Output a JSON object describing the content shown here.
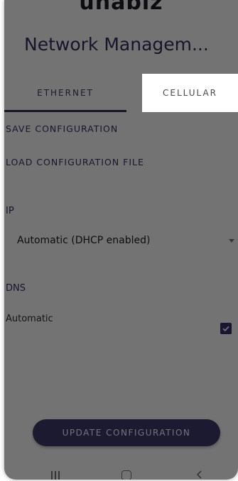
{
  "app": {
    "brand": "unabiz",
    "title": "Network Managem..."
  },
  "tabs": [
    {
      "label": "ETHERNET",
      "selected": true
    },
    {
      "label": "CELLULAR",
      "selected": false
    }
  ],
  "actions": {
    "save": "SAVE CONFIGURATION",
    "load": "LOAD CONFIGURATION FILE"
  },
  "ip": {
    "label": "IP",
    "selected": "Automatic (DHCP enabled)"
  },
  "dns": {
    "label": "DNS",
    "mode": "Automatic",
    "checked": true
  },
  "update_button": "UPDATE CONFIGURATION",
  "icons": {
    "recents": "recents-icon",
    "home": "home-icon",
    "back": "back-icon",
    "check": "check-icon",
    "dropdown": "chevron-down-icon"
  },
  "colors": {
    "accent": "#35305f",
    "scrim": "#000000"
  }
}
